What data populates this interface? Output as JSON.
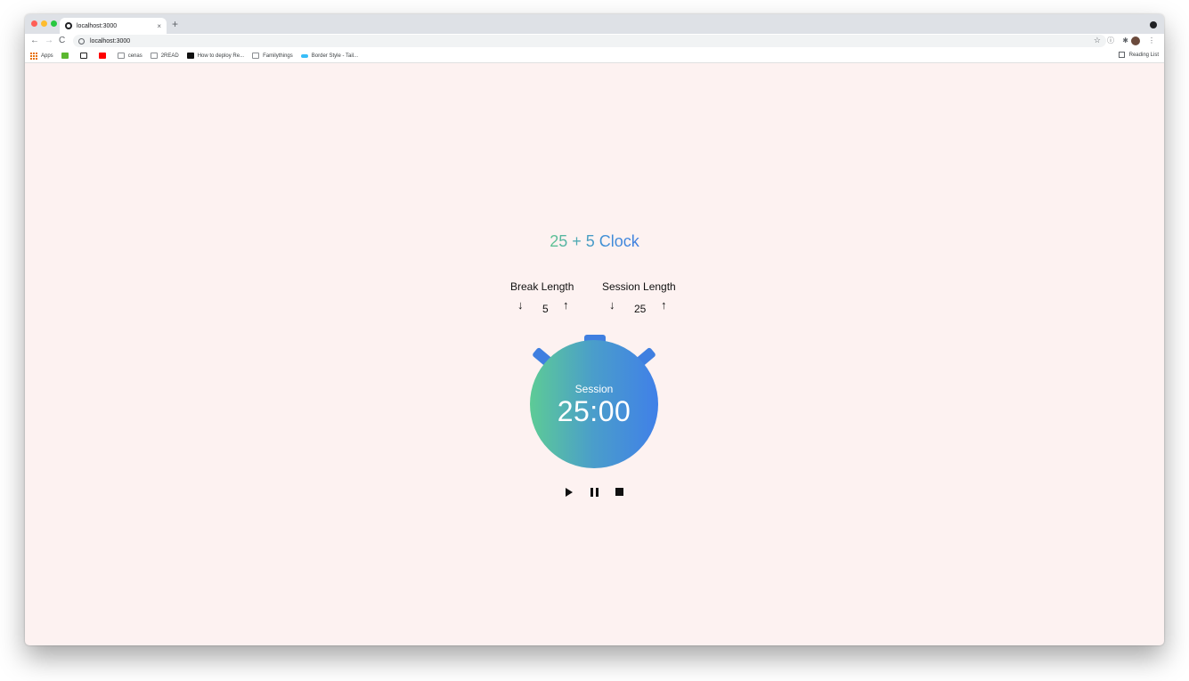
{
  "browser": {
    "tab_title": "localhost:3000",
    "tab_close": "×",
    "new_tab": "+",
    "url": "localhost:3000",
    "back": "←",
    "forward": "→",
    "reload": "C",
    "star": "☆",
    "menu": "⋮",
    "extension": "ⓘ",
    "puzzle": "✱"
  },
  "bookmarks": [
    {
      "label": "Apps",
      "icon": "apps-grid-icon",
      "color": "#e8710a"
    },
    {
      "label": "",
      "icon": "green-icon",
      "color": "#5bb72f"
    },
    {
      "label": "",
      "icon": "amazon-icon",
      "color": "#222222"
    },
    {
      "label": "",
      "icon": "youtube-icon",
      "color": "#ff0000"
    },
    {
      "label": "cenas",
      "icon": "folder-icon",
      "color": "#8a8d91"
    },
    {
      "label": "2READ",
      "icon": "folder-icon",
      "color": "#8a8d91"
    },
    {
      "label": "How to deploy Re...",
      "icon": "dev-icon",
      "color": "#111111"
    },
    {
      "label": "Familythings",
      "icon": "folder-icon",
      "color": "#8a8d91"
    },
    {
      "label": "Border Style - Tail...",
      "icon": "tailwind-icon",
      "color": "#38bdf8"
    }
  ],
  "reading_list": "Reading List",
  "app": {
    "title": "25 + 5 Clock",
    "break_label": "Break Length",
    "session_label": "Session Length",
    "break_value": "5",
    "session_value": "25",
    "decrement": "↓",
    "increment": "↑",
    "timer_label": "Session",
    "time_left": "25:00"
  },
  "colors": {
    "page_bg": "#fdf2f1",
    "accent_blue": "#3f7fe0",
    "accent_green": "#5dcb96"
  }
}
